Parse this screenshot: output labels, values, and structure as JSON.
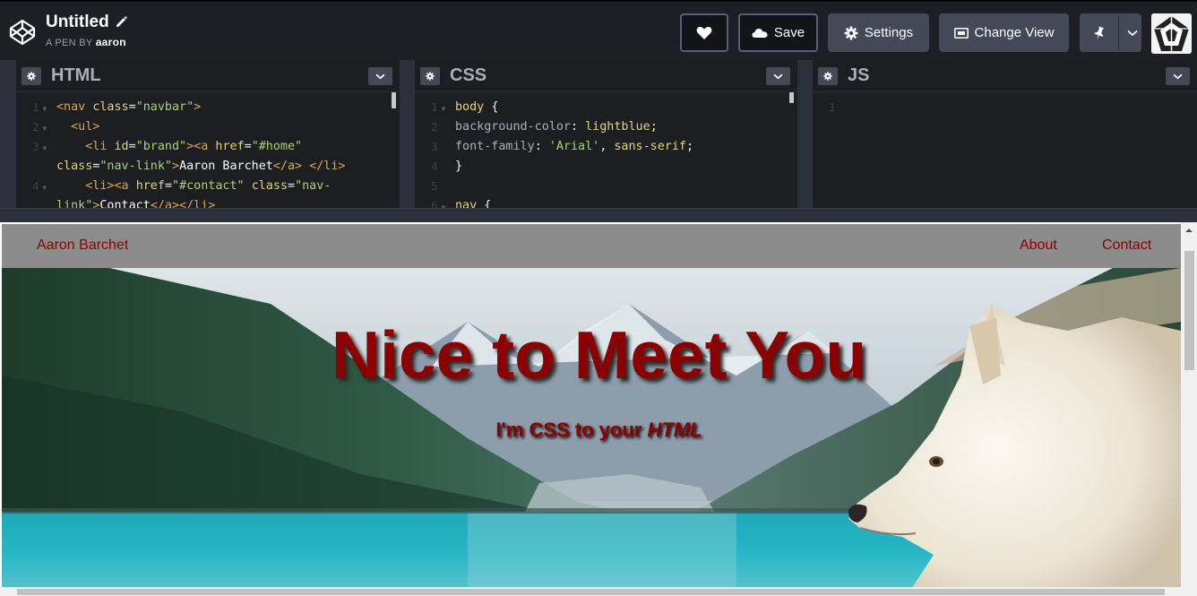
{
  "header": {
    "title": "Untitled",
    "byline_prefix": "A PEN BY",
    "author": "aaron",
    "buttons": {
      "save": "Save",
      "settings": "Settings",
      "change_view": "Change View"
    }
  },
  "editors": {
    "html": {
      "title": "HTML",
      "line_numbers": [
        "1",
        "2",
        "3",
        "",
        "4",
        ""
      ]
    },
    "css": {
      "title": "CSS",
      "line_numbers": [
        "1",
        "2",
        "3",
        "4",
        "5",
        "6"
      ]
    },
    "js": {
      "title": "JS",
      "line_numbers": [
        "1"
      ]
    }
  },
  "preview": {
    "nav": {
      "brand": "Aaron Barchet",
      "about": "About",
      "contact": "Contact"
    },
    "hero": {
      "title": "Nice to Meet You",
      "subtitle_part1": "I'm CSS to your ",
      "subtitle_part2": "HTML"
    }
  },
  "colors": {
    "accent_text": "#8b0000",
    "header_bg": "#1e1f26",
    "button_bg": "#444857",
    "nav_bg": "#8c8c8c"
  }
}
